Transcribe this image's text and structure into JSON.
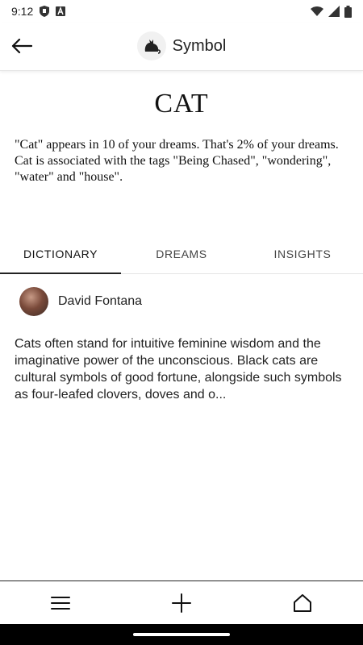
{
  "status_bar": {
    "time": "9:12"
  },
  "app_bar": {
    "title": "Symbol"
  },
  "symbol": {
    "name": "CAT",
    "summary": "\"Cat\" appears in 10 of your dreams. That's 2% of your dreams. Cat is associated with the tags \"Being Chased\", \"wondering\", \"water\" and \"house\"."
  },
  "tabs": [
    {
      "label": "DICTIONARY",
      "active": true
    },
    {
      "label": "DREAMS",
      "active": false
    },
    {
      "label": "INSIGHTS",
      "active": false
    }
  ],
  "dictionary": {
    "author": "David Fontana",
    "text": "Cats often stand for intuitive feminine wisdom and the imaginative power of the unconscious. Black cats are cultural symbols of good fortune, alongside such symbols as four-leafed clovers, doves and o..."
  },
  "icons": {
    "back": "arrow-left-icon",
    "logo": "cat-icon",
    "menu": "hamburger-menu-icon",
    "add": "plus-icon",
    "home": "home-icon"
  }
}
